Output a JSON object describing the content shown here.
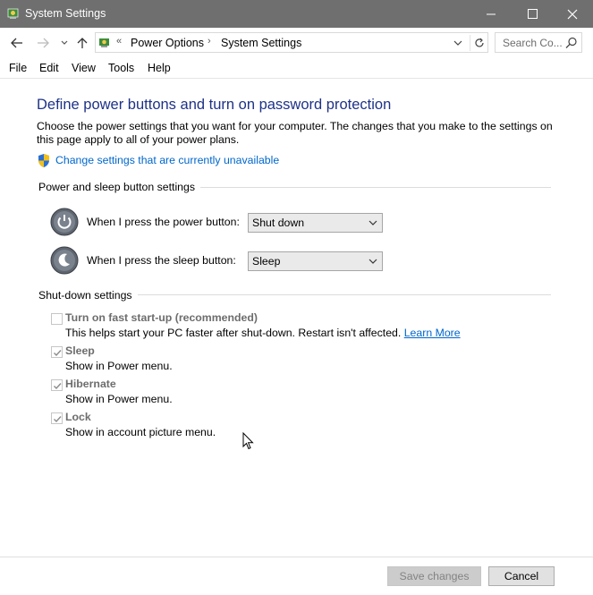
{
  "window": {
    "title": "System Settings"
  },
  "address": {
    "overflow": "«",
    "crumbs": [
      "Power Options",
      "System Settings"
    ],
    "search_placeholder": "Search Co..."
  },
  "menu": [
    "File",
    "Edit",
    "View",
    "Tools",
    "Help"
  ],
  "page": {
    "heading": "Define power buttons and turn on password protection",
    "description": "Choose the power settings that you want for your computer. The changes that you make to the settings on this page apply to all of your power plans.",
    "unlock_link": "Change settings that are currently unavailable"
  },
  "power_group": {
    "title": "Power and sleep button settings",
    "power_label": "When I press the power button:",
    "power_value": "Shut down",
    "sleep_label": "When I press the sleep button:",
    "sleep_value": "Sleep"
  },
  "shutdown_group": {
    "title": "Shut-down settings",
    "items": [
      {
        "label": "Turn on fast start-up (recommended)",
        "checked": false,
        "desc": "This helps start your PC faster after shut-down. Restart isn't affected.",
        "link": "Learn More"
      },
      {
        "label": "Sleep",
        "checked": true,
        "desc": "Show in Power menu."
      },
      {
        "label": "Hibernate",
        "checked": true,
        "desc": "Show in Power menu."
      },
      {
        "label": "Lock",
        "checked": true,
        "desc": "Show in account picture menu."
      }
    ]
  },
  "footer": {
    "save": "Save changes",
    "cancel": "Cancel"
  },
  "colors": {
    "heading": "#1e3287",
    "link": "#0066cc",
    "titlebar": "#6f6f6f"
  }
}
